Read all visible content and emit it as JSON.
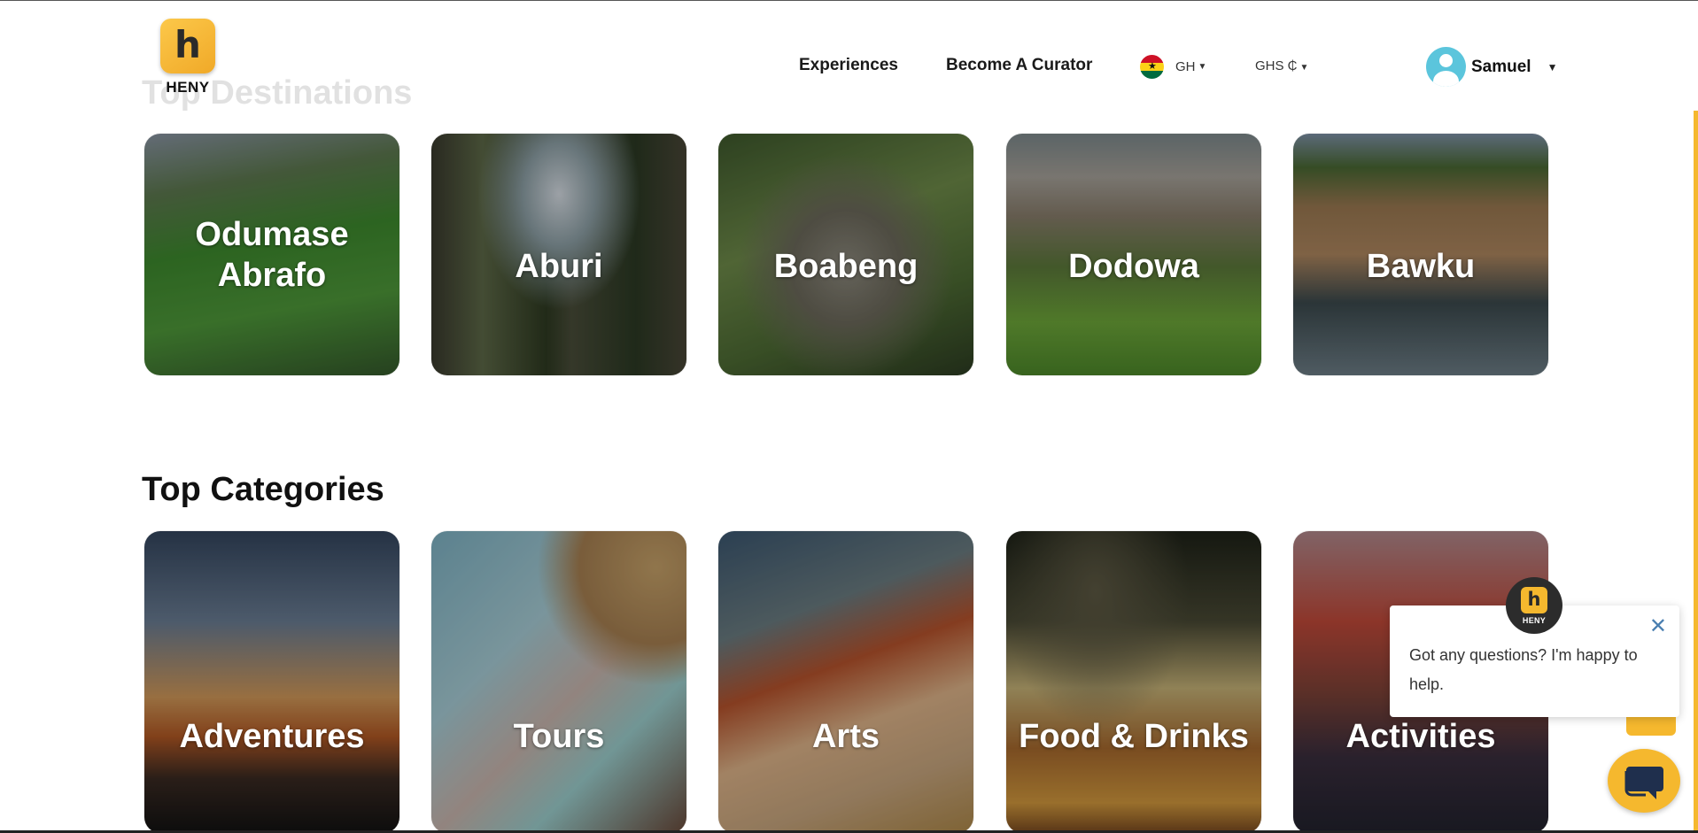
{
  "header": {
    "logo_text": "HENY",
    "logo_glyph": "h",
    "nav": [
      {
        "label": "Experiences"
      },
      {
        "label": "Become A Curator"
      }
    ],
    "country_code": "GH",
    "currency": "GHS ₵",
    "user_name": "Samuel"
  },
  "destinations": {
    "title": "Top Destinations",
    "cards": [
      {
        "label": "Odumase Abrafo"
      },
      {
        "label": "Aburi"
      },
      {
        "label": "Boabeng"
      },
      {
        "label": "Dodowa"
      },
      {
        "label": "Bawku"
      }
    ]
  },
  "categories": {
    "title": "Top Categories",
    "cards": [
      {
        "label": "Adventures"
      },
      {
        "label": "Tours"
      },
      {
        "label": "Arts"
      },
      {
        "label": "Food & Drinks"
      },
      {
        "label": "Activities"
      }
    ]
  },
  "chat": {
    "avatar_glyph": "h",
    "avatar_text": "HENY",
    "message": "Got any questions? I'm happy to help."
  },
  "colors": {
    "brand_yellow": "#f5b82e",
    "avatar_blue": "#5bc5dc",
    "text_dark": "#111111"
  },
  "icons": {
    "country": "ghana-flag-icon",
    "user": "user-avatar-icon",
    "close": "close-icon",
    "scroll_top": "chevron-up-icon",
    "chat": "chat-bubble-icon"
  }
}
